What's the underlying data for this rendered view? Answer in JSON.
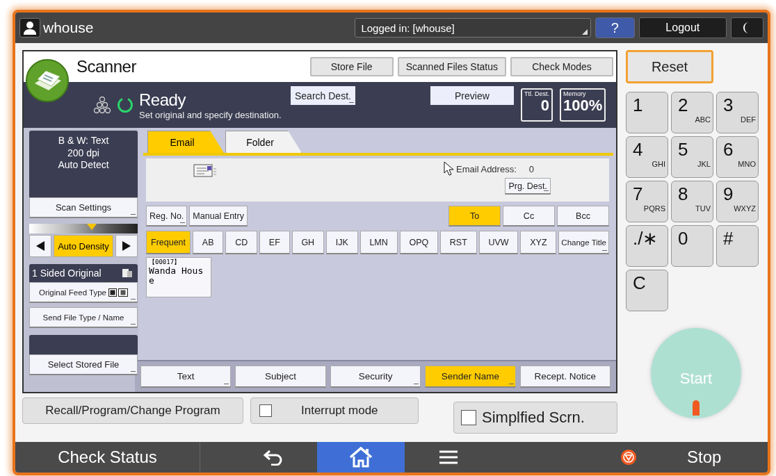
{
  "top_bar": {
    "user": "whouse",
    "login_status": "Logged in: [whouse]",
    "help": "?",
    "logout": "Logout"
  },
  "app": {
    "title": "Scanner",
    "header_buttons": [
      {
        "label": "Store File"
      },
      {
        "label": "Scanned Files Status"
      },
      {
        "label": "Check Modes"
      }
    ]
  },
  "status": {
    "state": "Ready",
    "message": "Set original and specify destination.",
    "search_button": {
      "label": "Search Dest.",
      "more": true
    },
    "preview_button": "Preview",
    "total_dest_label": "Ttl. Dest.",
    "total_dest": "0",
    "memory_label": "Memory",
    "memory": "100%"
  },
  "scan_summary": [
    "B & W: Text",
    "200 dpi",
    "Auto Detect"
  ],
  "scan_settings": {
    "label": "Scan Settings",
    "more": true
  },
  "density": {
    "level": 0.58,
    "label": "Auto Density",
    "selected": true
  },
  "original": {
    "sides": "1 Sided Original",
    "feed_type": {
      "label": "Original Feed Type",
      "more": true
    },
    "send_file_type": {
      "label": "Send File Type / Name",
      "more": true
    },
    "select_stored": {
      "label": "Select Stored File",
      "more": true
    }
  },
  "tabs": [
    {
      "label": "Email",
      "selected": true
    },
    {
      "label": "Folder",
      "selected": false
    }
  ],
  "destination": {
    "address_label": "Email Address:",
    "count": "0",
    "program_button": {
      "label": "Prg. Dest.",
      "more": true
    }
  },
  "entry_buttons": [
    {
      "label": "Reg. No.",
      "more": true
    },
    {
      "label": "Manual Entry",
      "more": false
    }
  ],
  "recipient_types": [
    {
      "label": "To",
      "selected": true
    },
    {
      "label": "Cc",
      "selected": false
    },
    {
      "label": "Bcc",
      "selected": false
    }
  ],
  "index_tabs": [
    {
      "label": "Frequent",
      "selected": true
    },
    {
      "label": "AB",
      "selected": false
    },
    {
      "label": "CD",
      "selected": false
    },
    {
      "label": "EF",
      "selected": false
    },
    {
      "label": "GH",
      "selected": false
    },
    {
      "label": "IJK",
      "selected": false
    },
    {
      "label": "LMN",
      "selected": false
    },
    {
      "label": "OPQ",
      "selected": false
    },
    {
      "label": "RST",
      "selected": false
    },
    {
      "label": "UVW",
      "selected": false
    },
    {
      "label": "XYZ",
      "selected": false
    }
  ],
  "change_title": {
    "label": "Change Title",
    "more": true
  },
  "address_entries": [
    {
      "number": "【00017】",
      "name_lines": [
        "Wanda Hous",
        "e"
      ],
      "selected": false
    }
  ],
  "options": [
    {
      "label": "Text",
      "more": true,
      "selected": false
    },
    {
      "label": "Subject",
      "more": false,
      "selected": false
    },
    {
      "label": "Security",
      "more": true,
      "selected": false
    },
    {
      "label": "Sender Name",
      "more": true,
      "selected": true
    },
    {
      "label": "Recept. Notice",
      "more": false,
      "selected": false
    }
  ],
  "bottom_buttons": {
    "recall": "Recall/Program/Change Program",
    "interrupt": {
      "label": "Interrupt mode",
      "checked": false
    },
    "simplified": {
      "label": "Simplfied Scrn.",
      "checked": false
    }
  },
  "reset": "Reset",
  "keypad": [
    {
      "digit": "1"
    },
    {
      "digit": "2",
      "letters": "ABC"
    },
    {
      "digit": "3",
      "letters": "DEF"
    },
    {
      "digit": "4",
      "letters": "GHI"
    },
    {
      "digit": "5",
      "letters": "JKL"
    },
    {
      "digit": "6",
      "letters": "MNO"
    },
    {
      "digit": "7",
      "letters": "PQRS"
    },
    {
      "digit": "8",
      "letters": "TUV"
    },
    {
      "digit": "9",
      "letters": "WXYZ"
    },
    {
      "digit": "./∗"
    },
    {
      "digit": "0"
    },
    {
      "digit": "#"
    },
    {
      "digit": "C"
    }
  ],
  "start": "Start",
  "bottom_bar": {
    "check_status": "Check Status",
    "nav": [
      {
        "kind": "back",
        "selected": false
      },
      {
        "kind": "home",
        "selected": true
      },
      {
        "kind": "menu",
        "selected": false
      }
    ],
    "stop": "Stop"
  }
}
